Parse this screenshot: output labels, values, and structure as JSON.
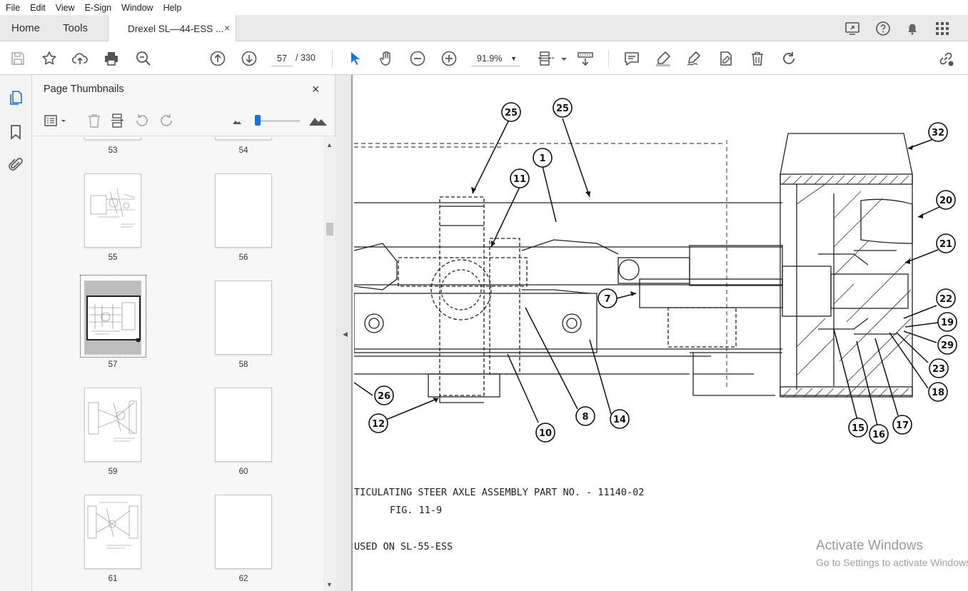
{
  "menu": [
    "File",
    "Edit",
    "View",
    "E-Sign",
    "Window",
    "Help"
  ],
  "tabs": {
    "home": "Home",
    "tools": "Tools",
    "document": "Drexel SL—44-ESS ...",
    "close": "×"
  },
  "toolbar": {
    "current_page": "57",
    "separator": "/",
    "total_pages": "330",
    "zoom": "91.9%"
  },
  "panel": {
    "title": "Page Thumbnails",
    "close": "×",
    "thumbnails": [
      {
        "label": "53"
      },
      {
        "label": "54"
      },
      {
        "label": "55"
      },
      {
        "label": "56"
      },
      {
        "label": "57",
        "selected": true
      },
      {
        "label": "58"
      },
      {
        "label": "59"
      },
      {
        "label": "60"
      },
      {
        "label": "61"
      },
      {
        "label": "62"
      }
    ]
  },
  "document": {
    "caption_line1": "TICULATING STEER AXLE ASSEMBLY PART NO. - 11140-02",
    "caption_line2": "FIG. 11-9",
    "caption_line3": "USED ON SL-55-ESS",
    "callouts": [
      "25",
      "25",
      "1",
      "11",
      "32",
      "20",
      "21",
      "22",
      "19",
      "29",
      "23",
      "18",
      "17",
      "16",
      "15",
      "7",
      "14",
      "8",
      "10",
      "12",
      "26"
    ]
  },
  "watermark": {
    "title": "Activate Windows",
    "subtitle": "Go to Settings to activate Windows."
  },
  "colors": {
    "accent": "#1473e6",
    "tab_bar": "#eaeaea",
    "panel_bg": "#f7f7f7"
  }
}
